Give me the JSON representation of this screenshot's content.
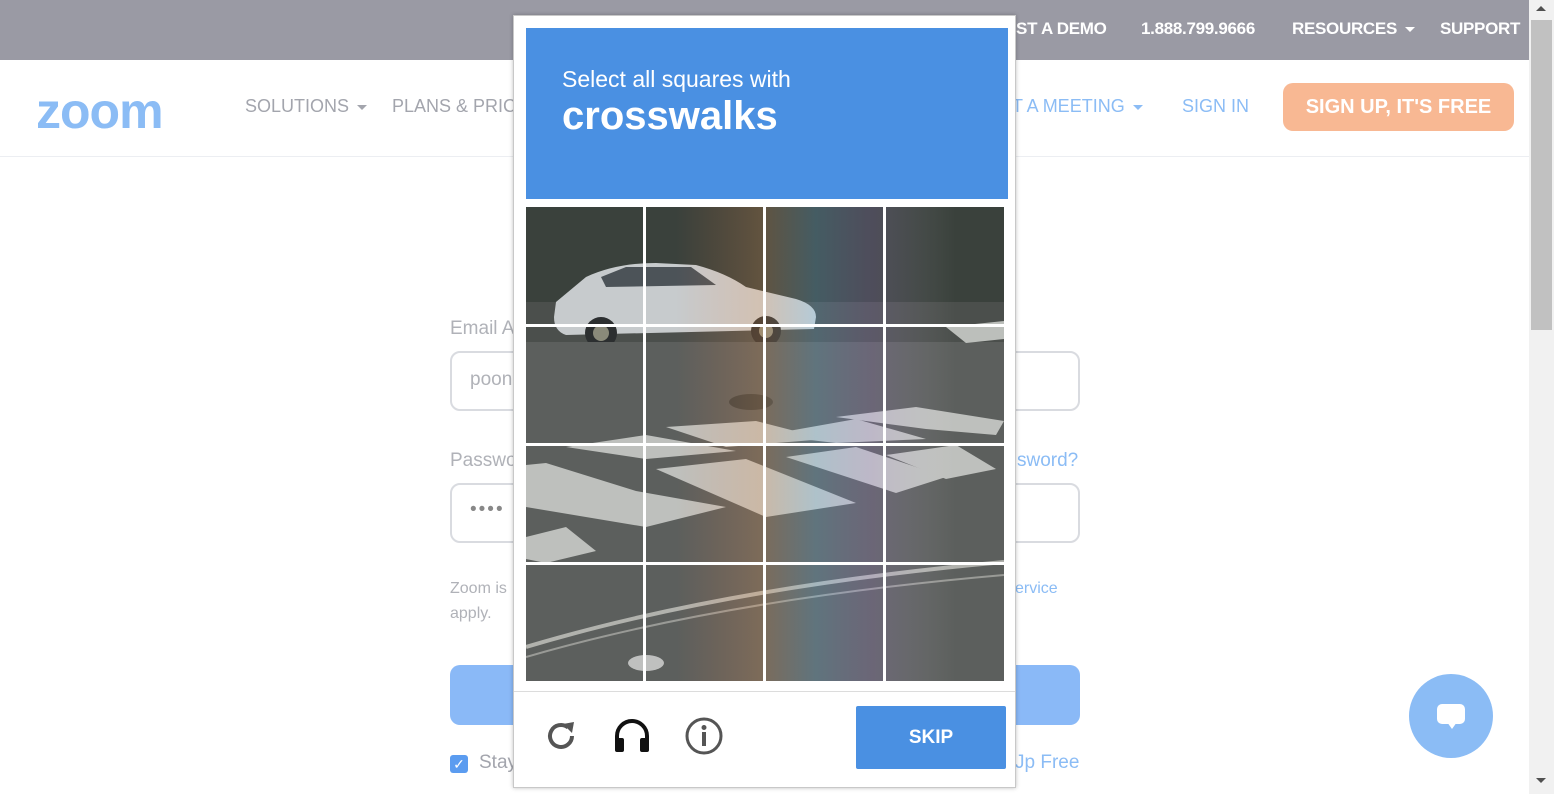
{
  "topbar": {
    "request_demo": "EST A DEMO",
    "phone": "1.888.799.9666",
    "resources": "RESOURCES",
    "support": "SUPPORT"
  },
  "nav": {
    "logo": "zoom",
    "solutions": "SOLUTIONS",
    "plans": "PLANS & PRICI",
    "join_meeting": "T A MEETING",
    "sign_in": "SIGN IN",
    "signup": "SIGN UP, IT'S FREE"
  },
  "form": {
    "email_label": "Email A",
    "email_value": "poon",
    "password_label": "Passwo",
    "forgot": "sword?",
    "password_value": "••••",
    "notice_line1_start": "Zoom is",
    "notice_line1_link": "ervice",
    "notice_line2": "apply.",
    "stay_label": "Stay",
    "signup_free": "Jp Free"
  },
  "captcha": {
    "instruction": "Select all squares with",
    "target": "crosswalks",
    "skip_label": "SKIP",
    "reload_icon": "reload-icon",
    "audio_icon": "headphones-icon",
    "info_icon": "info-icon"
  },
  "colors": {
    "zoom_blue": "#8bbcf5",
    "signup_orange": "#f8b893",
    "captcha_blue": "#4a90e2",
    "topbar_gray": "#9a9aa4"
  }
}
